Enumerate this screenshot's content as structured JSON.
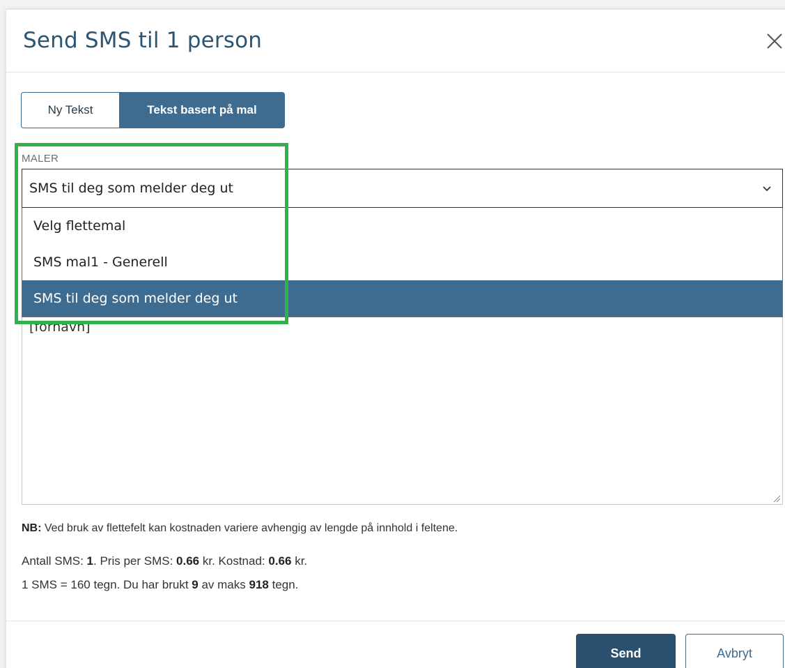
{
  "modal": {
    "title": "Send SMS til 1 person",
    "close_icon": "close-icon"
  },
  "tabs": [
    {
      "label": "Ny Tekst",
      "active": false
    },
    {
      "label": "Tekst basert på mal",
      "active": true
    }
  ],
  "templates": {
    "label": "MALER",
    "selected_value": "SMS til deg som melder deg ut",
    "options": [
      {
        "label": "Velg flettemal",
        "selected": false
      },
      {
        "label": "SMS mal1 - Generell",
        "selected": false
      },
      {
        "label": "SMS til deg som melder deg ut",
        "selected": true
      }
    ],
    "chevron_icon": "chevron-down-icon"
  },
  "message": {
    "text": "[fornavn]"
  },
  "info": {
    "note_prefix": "NB:",
    "note_text": " Ved bruk av flettefelt kan kostnaden variere avhengig av lengde på innhold i feltene.",
    "count_label": "Antall SMS: ",
    "count_value": "1",
    "price_label": ".  Pris per SMS: ",
    "price_value": "0.66",
    "price_unit": " kr.  Kostnad: ",
    "cost_value": "0.66",
    "cost_unit": " kr.",
    "chars_label": "1 SMS = 160 tegn.  Du har brukt ",
    "chars_used": "9",
    "chars_mid": " av maks ",
    "chars_max": "918",
    "chars_unit": " tegn."
  },
  "footer": {
    "send_label": "Send",
    "cancel_label": "Avbryt"
  },
  "colors": {
    "accent": "#3e6c91",
    "highlight": "#2fb24c"
  }
}
